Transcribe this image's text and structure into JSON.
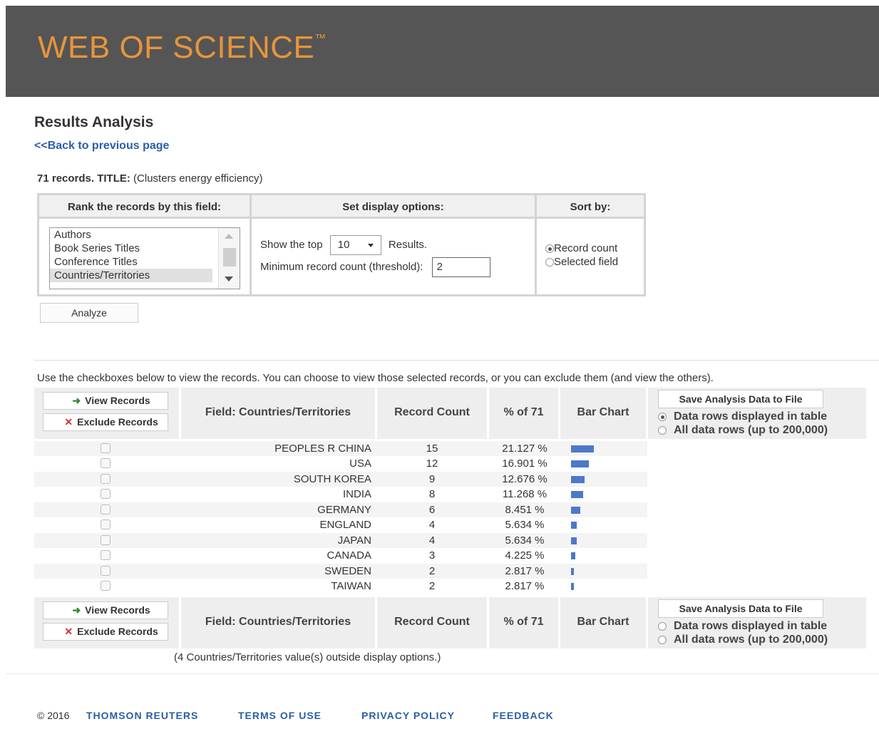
{
  "header": {
    "brand": "WEB OF SCIENCE",
    "tm": "™"
  },
  "page": {
    "title": "Results Analysis",
    "back_link": "<<Back to previous page",
    "summary_bold": "71 records. TITLE:",
    "summary_rest": " (Clusters energy efficiency)"
  },
  "options": {
    "rank_header": "Rank the records by this field:",
    "display_header": "Set display options:",
    "sort_header": "Sort by:",
    "fields": [
      "Authors",
      "Book Series Titles",
      "Conference Titles",
      "Countries/Territories"
    ],
    "selected_field": "Countries/Territories",
    "show_top_label": "Show the top",
    "show_top_value": "10",
    "results_label": "Results.",
    "min_count_label": "Minimum record count (threshold):",
    "min_count_value": "2",
    "sort_record_count": "Record count",
    "sort_selected_field": "Selected field",
    "analyze_label": "Analyze"
  },
  "instructions": "Use the checkboxes below to view the records. You can choose to view those selected records, or you can exclude them (and view the others).",
  "table": {
    "view_records": "View Records",
    "exclude_records": "Exclude Records",
    "col_field": "Field: Countries/Territories",
    "col_count": "Record Count",
    "col_pct": "% of 71",
    "col_bar": "Bar Chart",
    "save_button": "Save Analysis Data to File",
    "save_opt_displayed": "Data rows displayed in table",
    "save_opt_all": "All data rows (up to 200,000)",
    "rows": [
      {
        "country": "PEOPLES R CHINA",
        "count": "15",
        "pct": "21.127 %",
        "fraction": 0.21127
      },
      {
        "country": "USA",
        "count": "12",
        "pct": "16.901 %",
        "fraction": 0.16901
      },
      {
        "country": "SOUTH KOREA",
        "count": "9",
        "pct": "12.676 %",
        "fraction": 0.12676
      },
      {
        "country": "INDIA",
        "count": "8",
        "pct": "11.268 %",
        "fraction": 0.11268
      },
      {
        "country": "GERMANY",
        "count": "6",
        "pct": "8.451 %",
        "fraction": 0.08451
      },
      {
        "country": "ENGLAND",
        "count": "4",
        "pct": "5.634 %",
        "fraction": 0.05634
      },
      {
        "country": "JAPAN",
        "count": "4",
        "pct": "5.634 %",
        "fraction": 0.05634
      },
      {
        "country": "CANADA",
        "count": "3",
        "pct": "4.225 %",
        "fraction": 0.04225
      },
      {
        "country": "SWEDEN",
        "count": "2",
        "pct": "2.817 %",
        "fraction": 0.02817
      },
      {
        "country": "TAIWAN",
        "count": "2",
        "pct": "2.817 %",
        "fraction": 0.02817
      }
    ],
    "outside_note": "(4 Countries/Territories value(s) outside display options.)"
  },
  "footer": {
    "copyright": "© 2016",
    "company": "THOMSON REUTERS",
    "terms": "TERMS OF USE",
    "privacy": "PRIVACY POLICY",
    "feedback": "FEEDBACK"
  },
  "colors": {
    "brand": "#e8953a",
    "header_bg": "#555555",
    "link": "#2a5ea8",
    "bar": "#4d79c7"
  }
}
